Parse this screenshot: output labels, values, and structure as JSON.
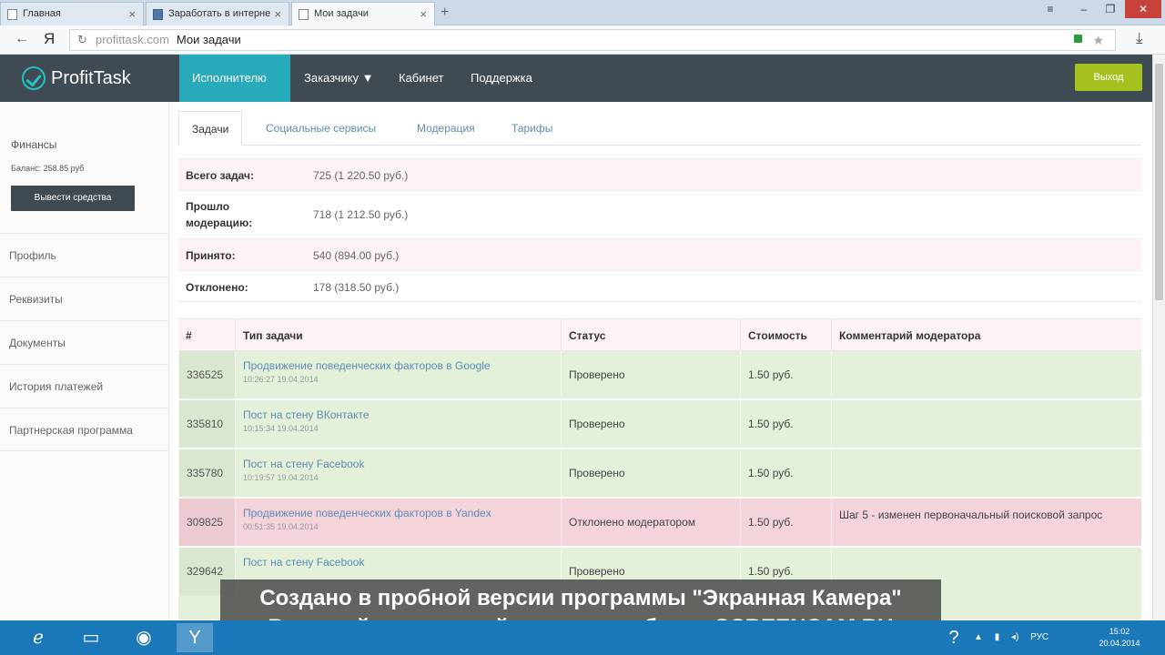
{
  "browser": {
    "tabs": [
      {
        "label": "Главная"
      },
      {
        "label": "Заработать в интерне"
      },
      {
        "label": "Мои задачи",
        "active": true
      }
    ],
    "new_tab": "+",
    "address": {
      "host": "profittask.com",
      "page_title": "Мои задачи"
    },
    "yandex_logo": "Я"
  },
  "site": {
    "logo": "ProfitTask",
    "nav": [
      {
        "label": "Исполнителю ▼",
        "active": true
      },
      {
        "label": "Заказчику ▼"
      },
      {
        "label": "Кабинет"
      },
      {
        "label": "Поддержка"
      }
    ],
    "exit_label": "Выход"
  },
  "sidebar": {
    "finance_title": "Финансы",
    "balance": "Баланс: 258.85 руб",
    "withdraw_label": "Вывести средства",
    "items": [
      "Профиль",
      "Реквизиты",
      "Документы",
      "История платежей",
      "Партнерская программа"
    ]
  },
  "main": {
    "tabs": [
      "Задачи",
      "Социальные сервисы",
      "Модерация",
      "Тарифы"
    ],
    "stats": [
      {
        "label": "Всего задач:",
        "value": "725 (1 220.50 руб.)"
      },
      {
        "label": "Прошло модерацию:",
        "value": "718 (1 212.50 руб.)"
      },
      {
        "label": "Принято:",
        "value": "540 (894.00 руб.)"
      },
      {
        "label": "Отклонено:",
        "value": "178 (318.50 руб.)"
      }
    ],
    "table": {
      "headers": [
        "#",
        "Тип задачи",
        "Статус",
        "Стоимость",
        "Комментарий модератора"
      ],
      "rows": [
        {
          "id": "336525",
          "title": "Продвижение поведенческих факторов в Google",
          "time": "10:26:27 19.04.2014",
          "status": "Проверено",
          "cost": "1.50 руб.",
          "comment": "",
          "state": "ok"
        },
        {
          "id": "335810",
          "title": "Пост на стену ВКонтакте",
          "time": "10:15:34 19.04.2014",
          "status": "Проверено",
          "cost": "1.50 руб.",
          "comment": "",
          "state": "ok"
        },
        {
          "id": "335780",
          "title": "Пост на стену Facebook",
          "time": "10:19:57 19.04.2014",
          "status": "Проверено",
          "cost": "1.50 руб.",
          "comment": "",
          "state": "ok"
        },
        {
          "id": "309825",
          "title": "Продвижение поведенческих факторов в Yandex",
          "time": "00:51:35 19.04.2014",
          "status": "Отклонено модератором",
          "cost": "1.50 руб.",
          "comment": "Шаг 5 - изменен первоначальный поисковой запрос",
          "state": "bad"
        },
        {
          "id": "329642",
          "title": "Пост на стену Facebook",
          "time": "",
          "status": "Проверено",
          "cost": "1.50 руб.",
          "comment": "",
          "state": "ok"
        }
      ]
    }
  },
  "watermark": {
    "line1": "Создано в пробной версии программы \"Экранная Камера\"",
    "line2": "В полной версии этой надписи не будет. SCREENCAM.RU"
  },
  "taskbar": {
    "lang": "РУС",
    "time": "15:02",
    "date": "20.04.2014"
  },
  "colors": {
    "header": "#3f4a52",
    "accent": "#27aab9",
    "exit": "#a5c11f",
    "ok_row": "#e4f0da",
    "bad_row": "#f5d3db"
  }
}
